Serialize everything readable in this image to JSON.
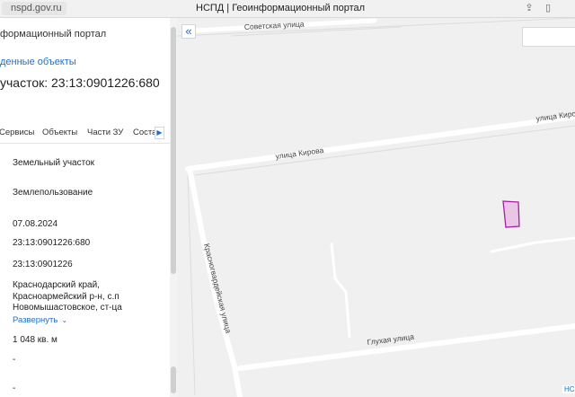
{
  "browser": {
    "url": "nspd.gov.ru",
    "tab_title": "НСПД | Геоинформационный портал"
  },
  "panel": {
    "portal_name": "формационный портал",
    "found_objects_link": "денные объекты",
    "parcel_title": "участок: 23:13:0901226:680",
    "tabs": [
      "Сервисы",
      "Объекты",
      "Части ЗУ",
      "Соста"
    ],
    "fields": {
      "type": "Земельный участок",
      "kind": "Землепользование",
      "date": "07.08.2024",
      "cadastral_number": "23:13:0901226:680",
      "quarter": "23:13:0901226",
      "address_line1": "Краснодарский край,",
      "address_line2": "Красноармейский р-н, с.п",
      "address_line3": "Новомышастовское, ст-ца",
      "expand_label": "Развернуть",
      "area": "1 048 кв. м",
      "dash1": "-",
      "dash2": "-"
    }
  },
  "map": {
    "streets": {
      "sovetskaya": "Советская улица",
      "kirova_1": "улица Кирова",
      "kirova_2": "улица Кирова",
      "krasnogvardeyskaya": "Красногвардейская улица",
      "glukhaya": "Глухая улица"
    },
    "corner_label": "НС",
    "parcel_color": "#a5209e"
  },
  "icons": {
    "collapse": "double-chevron-left-icon",
    "tab_next": "chevron-right-icon",
    "expand": "chevron-down-icon",
    "share": "share-icon",
    "bookmark": "bookmark-icon"
  }
}
